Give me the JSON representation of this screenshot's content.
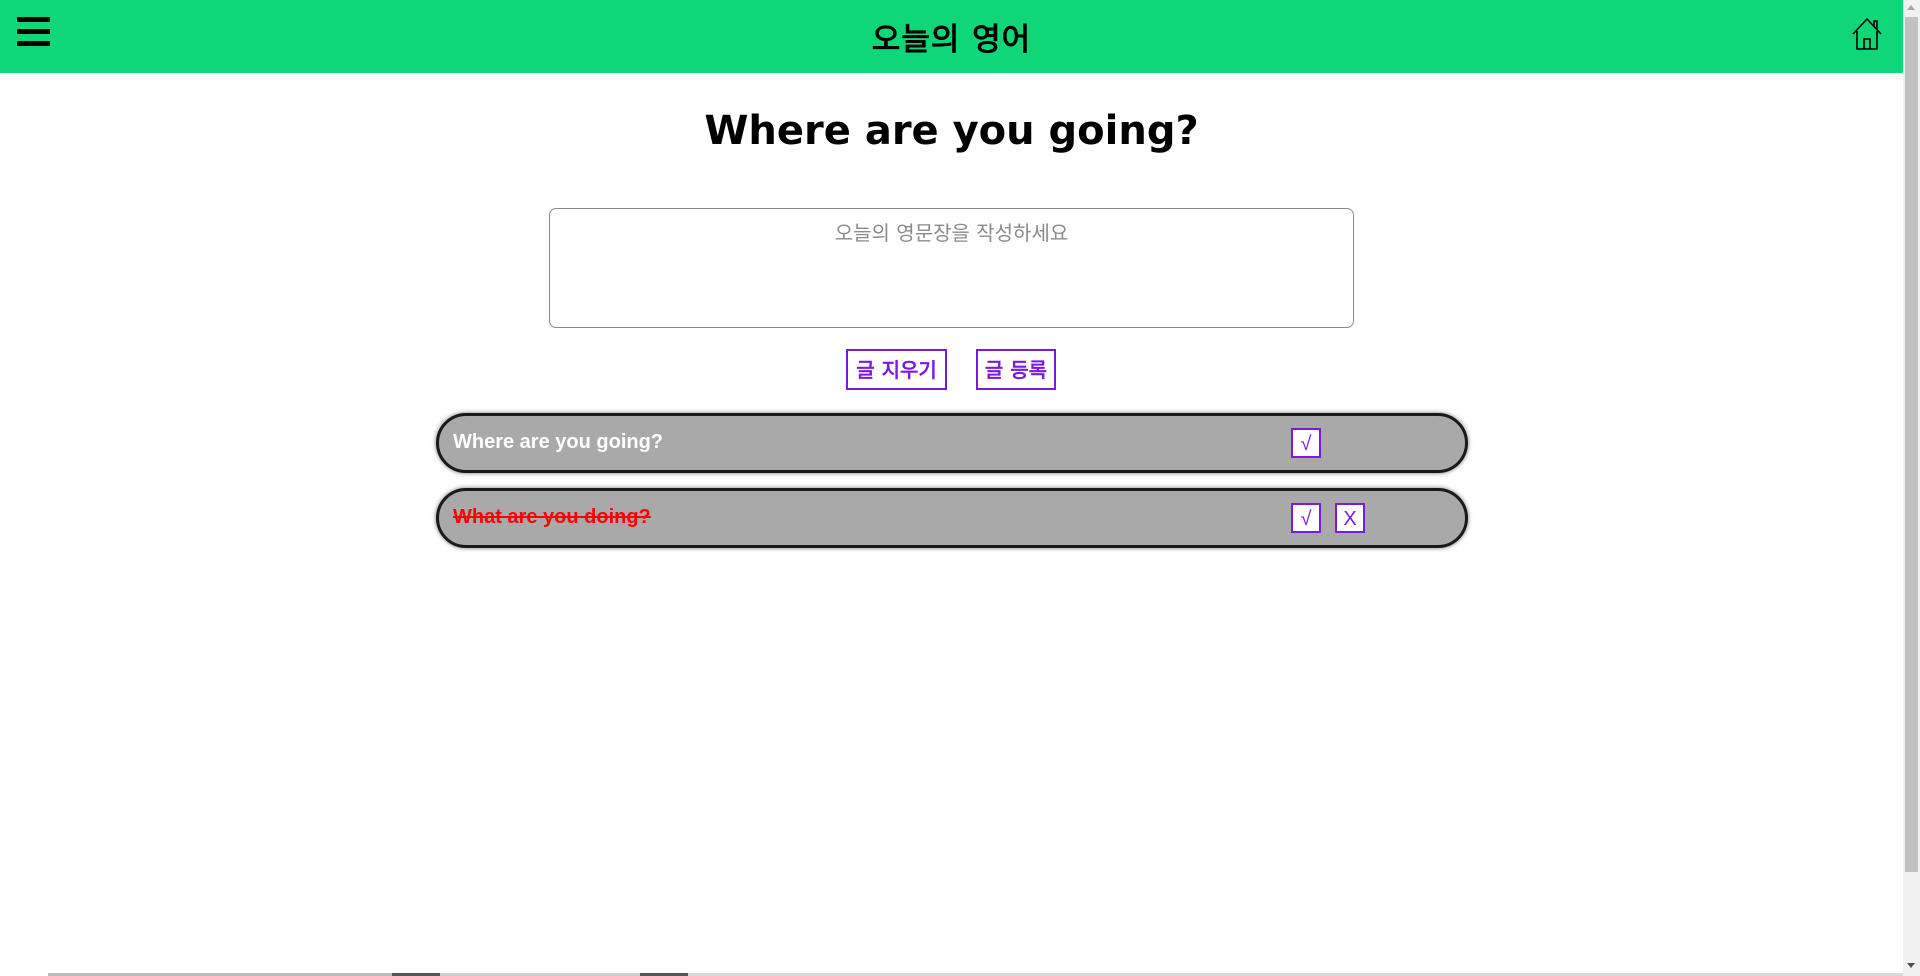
{
  "header": {
    "title": "오늘의 영어",
    "menu_icon": "hamburger-menu-icon",
    "home_icon": "home-icon",
    "background": "#0fd676"
  },
  "main": {
    "heading": "Where are you going?",
    "input": {
      "placeholder": "오늘의 영문장을 작성하세요",
      "value": ""
    },
    "buttons": {
      "clear_label": "글 지우기",
      "submit_label": "글 등록"
    },
    "items": [
      {
        "text": "Where are you going?",
        "done": false,
        "check_label": "√"
      },
      {
        "text": "What are you doing?",
        "done": true,
        "check_label": "√",
        "delete_label": "X"
      }
    ]
  },
  "colors": {
    "accent": "#7b19e0",
    "item_bg": "#a9a9a9",
    "done_text": "#ff0000"
  }
}
